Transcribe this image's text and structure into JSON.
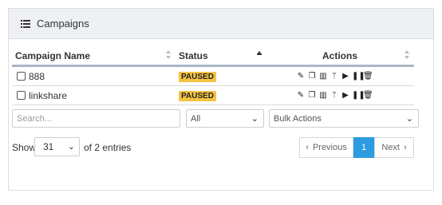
{
  "panel": {
    "title": "Campaigns"
  },
  "table": {
    "columns": {
      "name": "Campaign Name",
      "status": "Status",
      "actions": "Actions"
    },
    "rows": [
      {
        "name": "888",
        "status": "PAUSED"
      },
      {
        "name": "linkshare",
        "status": "PAUSED"
      }
    ],
    "action_icons": [
      "edit-icon",
      "copy-icon",
      "bar-chart-icon",
      "split-icon",
      "play-icon",
      "pause-icon",
      "trash-icon"
    ]
  },
  "filters": {
    "search_placeholder": "Search...",
    "status_value": "All",
    "bulk_value": "Bulk Actions"
  },
  "footer": {
    "show_label": "Show",
    "page_length": "31",
    "entries_text": "of 2 entries"
  },
  "pagination": {
    "prev": "Previous",
    "current": "1",
    "next": "Next"
  },
  "colors": {
    "badge": "#f5c342",
    "active_page": "#2d9be0",
    "header_bg": "#eef0f3"
  }
}
